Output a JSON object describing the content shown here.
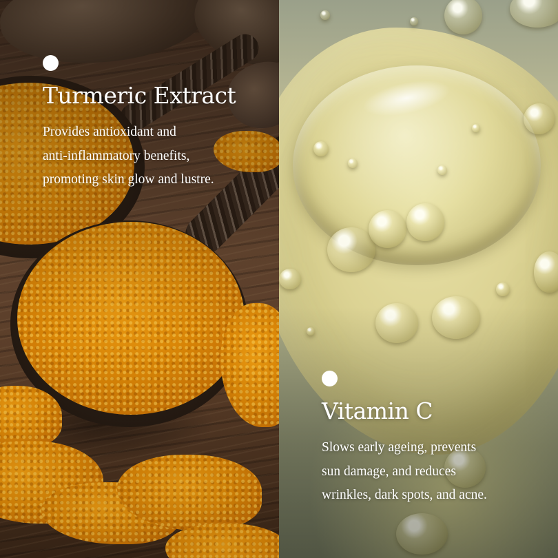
{
  "ingredients": [
    {
      "name": "Turmeric Extract",
      "description_lines": [
        "Provides antioxidant and",
        "anti-inflammatory benefits,",
        "promoting skin glow and lustre."
      ],
      "image": "turmeric-powder-on-wooden-spoons"
    },
    {
      "name": "Vitamin C",
      "description_lines": [
        "Slows early ageing, prevents",
        "sun damage, and reduces",
        "wrinkles, dark spots, and acne."
      ],
      "image": "serum-droplet-with-bubbles"
    }
  ],
  "colors": {
    "text": "#ffffff",
    "turmeric": "#e08c0e",
    "serum": "#dcd394"
  }
}
